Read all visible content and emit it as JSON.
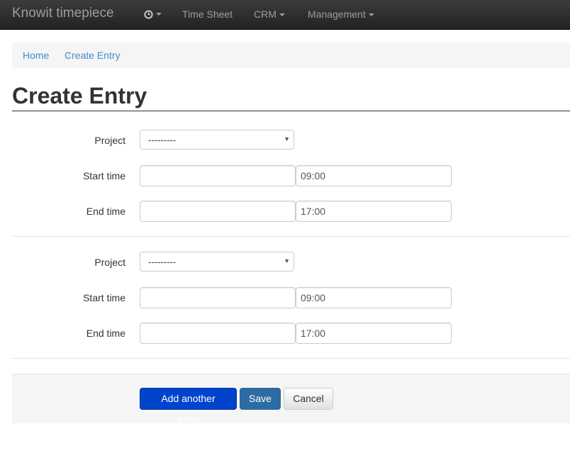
{
  "navbar": {
    "brand": "Knowit timepiece",
    "clock_icon": "clock-icon",
    "items": [
      {
        "label": "Time Sheet"
      },
      {
        "label": "CRM"
      },
      {
        "label": "Management"
      }
    ]
  },
  "breadcrumb": {
    "home": "Home",
    "separator": "/",
    "current": "Create Entry"
  },
  "page_title": "Create Entry",
  "entries": [
    {
      "project_label": "Project",
      "project_value": "---------",
      "start_label": "Start time",
      "start_date": "",
      "start_time": "09:00",
      "end_label": "End time",
      "end_date": "",
      "end_time": "17:00"
    },
    {
      "project_label": "Project",
      "project_value": "---------",
      "start_label": "Start time",
      "start_date": "",
      "start_time": "09:00",
      "end_label": "End time",
      "end_date": "",
      "end_time": "17:00"
    }
  ],
  "actions": {
    "add_label": "Add another entry",
    "save_label": "Save",
    "cancel_label": "Cancel"
  },
  "colors": {
    "navbar_bg": "#222222",
    "link": "#428bca",
    "primary": "#0044cc"
  }
}
